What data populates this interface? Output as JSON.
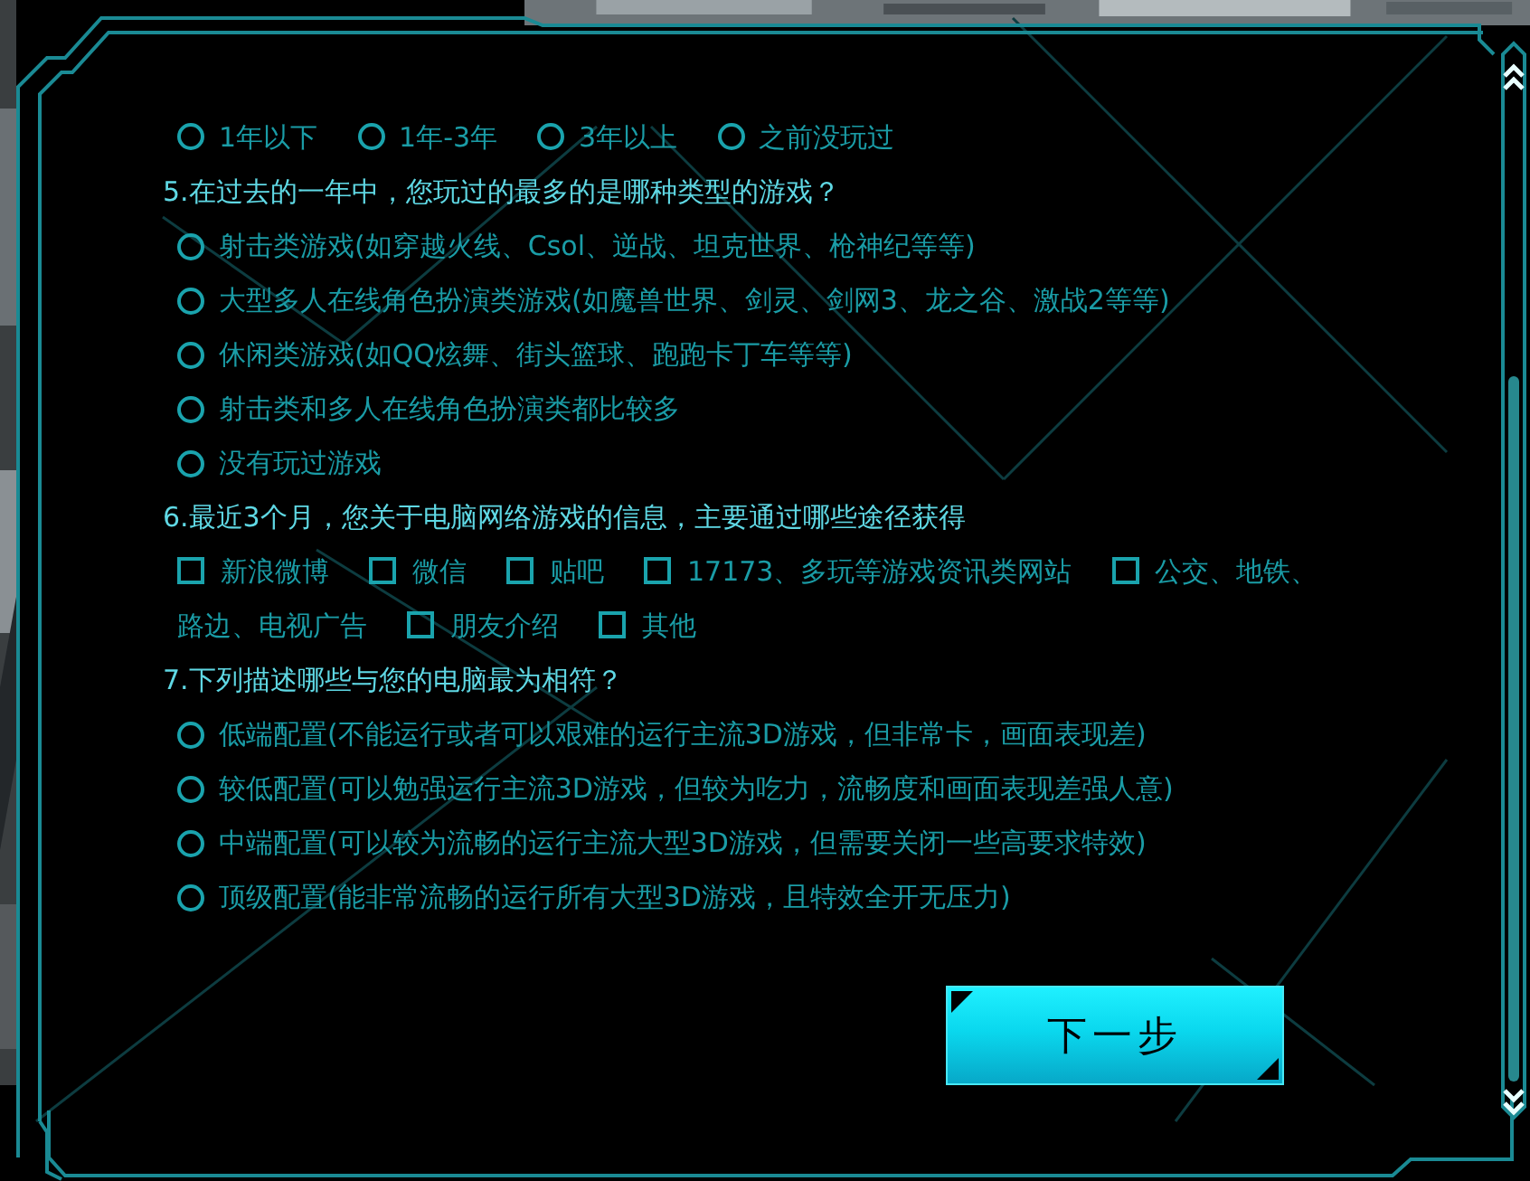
{
  "questions": [
    {
      "kind": "radio-row",
      "options": [
        {
          "label": "1年以下",
          "selected": false
        },
        {
          "label": "1年-3年",
          "selected": false
        },
        {
          "label": "3年以上",
          "selected": false
        },
        {
          "label": "之前没玩过",
          "selected": false
        }
      ]
    },
    {
      "title": "5.在过去的一年中，您玩过的最多的是哪种类型的游戏？",
      "kind": "radio-list",
      "options": [
        {
          "label": "射击类游戏(如穿越火线、Csol、逆战、坦克世界、枪神纪等等)",
          "selected": false
        },
        {
          "label": "大型多人在线角色扮演类游戏(如魔兽世界、剑灵、剑网3、龙之谷、激战2等等)",
          "selected": false
        },
        {
          "label": "休闲类游戏(如QQ炫舞、街头篮球、跑跑卡丁车等等)",
          "selected": false
        },
        {
          "label": "射击类和多人在线角色扮演类都比较多",
          "selected": false
        },
        {
          "label": "没有玩过游戏",
          "selected": false
        }
      ]
    },
    {
      "title": "6.最近3个月，您关于电脑网络游戏的信息，主要通过哪些途径获得",
      "kind": "checkbox-row",
      "options": [
        {
          "label_lines": [
            "新浪微博"
          ],
          "checked": false
        },
        {
          "label_lines": [
            "微信"
          ],
          "checked": false
        },
        {
          "label_lines": [
            "贴吧"
          ],
          "checked": false
        },
        {
          "label_lines": [
            "17173、多玩等游戏资讯类网站"
          ],
          "checked": false
        },
        {
          "label_lines": [
            "公交、地铁、",
            "路边、电视广告"
          ],
          "checked": false
        },
        {
          "label_lines": [
            "朋友介绍"
          ],
          "checked": false
        },
        {
          "label_lines": [
            "其他"
          ],
          "checked": false
        }
      ]
    },
    {
      "title": "7.下列描述哪些与您的电脑最为相符？",
      "kind": "radio-list",
      "options": [
        {
          "label": "低端配置(不能运行或者可以艰难的运行主流3D游戏，但非常卡，画面表现差)",
          "selected": false
        },
        {
          "label": "较低配置(可以勉强运行主流3D游戏，但较为吃力，流畅度和画面表现差强人意)",
          "selected": false
        },
        {
          "label": "中端配置(可以较为流畅的运行主流大型3D游戏，但需要关闭一些高要求特效)",
          "selected": false
        },
        {
          "label": "顶级配置(能非常流畅的运行所有大型3D游戏，且特效全开无压力)",
          "selected": false
        }
      ]
    }
  ],
  "next_button": "下一步"
}
